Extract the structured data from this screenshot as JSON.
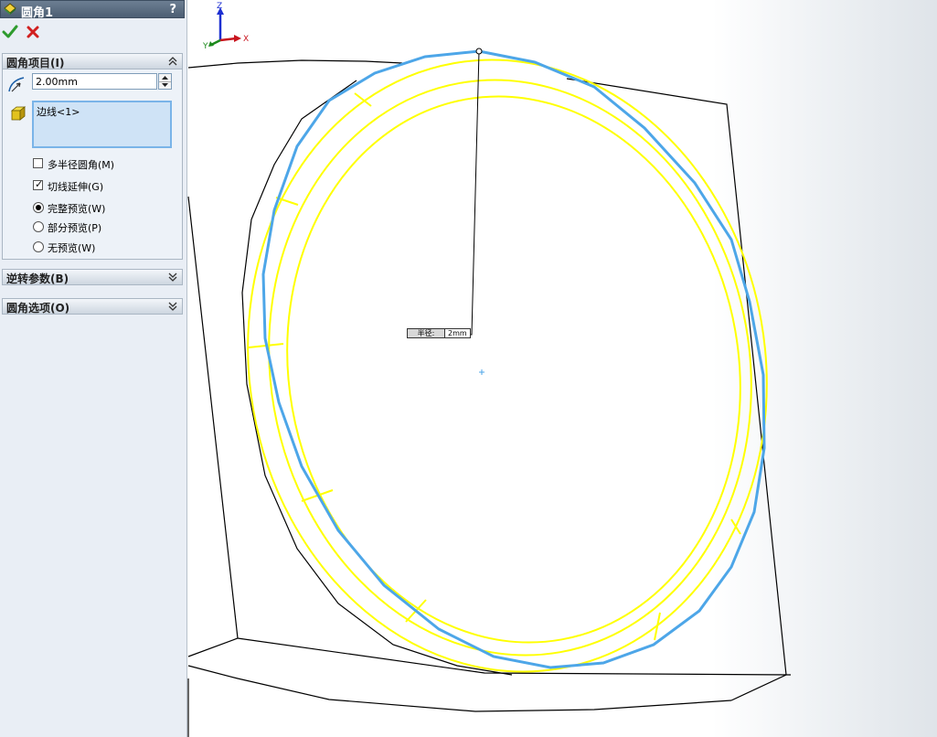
{
  "window": {
    "title": "圆角1",
    "help": "?"
  },
  "actions": {
    "ok_icon": "green-check-icon",
    "cancel_icon": "red-x-icon"
  },
  "sections": {
    "fillet_items": {
      "title": "圆角项目(I)",
      "radius_value": "2.00mm",
      "edges": [
        "边线<1>"
      ],
      "options": {
        "multi_radius": {
          "label": "多半径圆角(M)",
          "checked": false
        },
        "tangent_propagation": {
          "label": "切线延伸(G)",
          "checked": true
        },
        "full_preview": {
          "label": "完整预览(W)",
          "selected": true
        },
        "partial_preview": {
          "label": "部分预览(P)",
          "selected": false
        },
        "no_preview": {
          "label": "无预览(W)",
          "selected": false
        }
      }
    },
    "setback": {
      "title": "逆转参数(B)"
    },
    "fillet_options": {
      "title": "圆角选项(O)"
    }
  },
  "graphics": {
    "dimension_label": "半径:",
    "dimension_value": "2mm",
    "triad": {
      "z": "Z",
      "y": "Y",
      "x": "X"
    },
    "colors": {
      "preview": "#ffff00",
      "selected_edge": "#4da6e8",
      "model_edges": "#000000"
    }
  }
}
